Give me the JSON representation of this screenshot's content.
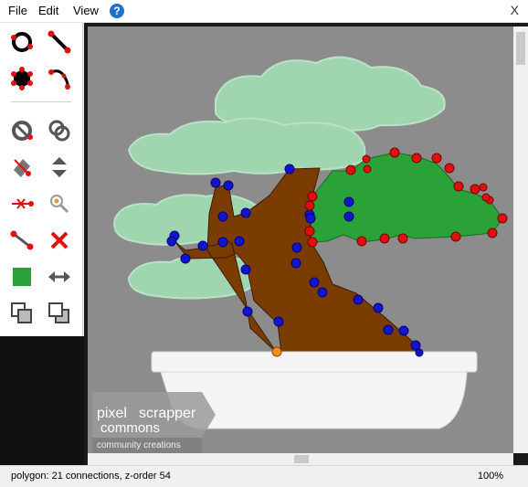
{
  "menu": {
    "file": "File",
    "edit": "Edit",
    "view": "View",
    "help_glyph": "?",
    "close_glyph": "X"
  },
  "tools": [
    {
      "name": "ring-tool-icon"
    },
    {
      "name": "line-tool-icon"
    },
    {
      "name": "polygon-tool-icon"
    },
    {
      "name": "bezier-tool-icon"
    },
    {
      "name": "cut-ring-tool-icon"
    },
    {
      "name": "overlap-tool-icon"
    },
    {
      "name": "erase-tool-icon"
    },
    {
      "name": "order-up-down-icon"
    },
    {
      "name": "split-point-icon"
    },
    {
      "name": "zoom-point-icon"
    },
    {
      "name": "connect-points-icon"
    },
    {
      "name": "delete-icon"
    },
    {
      "name": "fill-color-icon"
    },
    {
      "name": "flip-horizontal-icon"
    },
    {
      "name": "bring-front-icon"
    },
    {
      "name": "send-back-icon"
    }
  ],
  "colors": {
    "canvas_bg": "#8c8c8c",
    "foliage": "#9fd6b0",
    "trunk": "#7a3c00",
    "leaf_poly": "#2aa238",
    "blue_point": "#1414c8",
    "red_point": "#e01010",
    "orange_point": "#ff8c1a",
    "pot": "#f4f4f4"
  },
  "logo": {
    "line1": "pixel",
    "line2": "scrapper",
    "line3": "commons",
    "tagline": "community creations"
  },
  "status": {
    "text": "polygon: 21 connections, z-order 54",
    "zoom": "100%"
  }
}
